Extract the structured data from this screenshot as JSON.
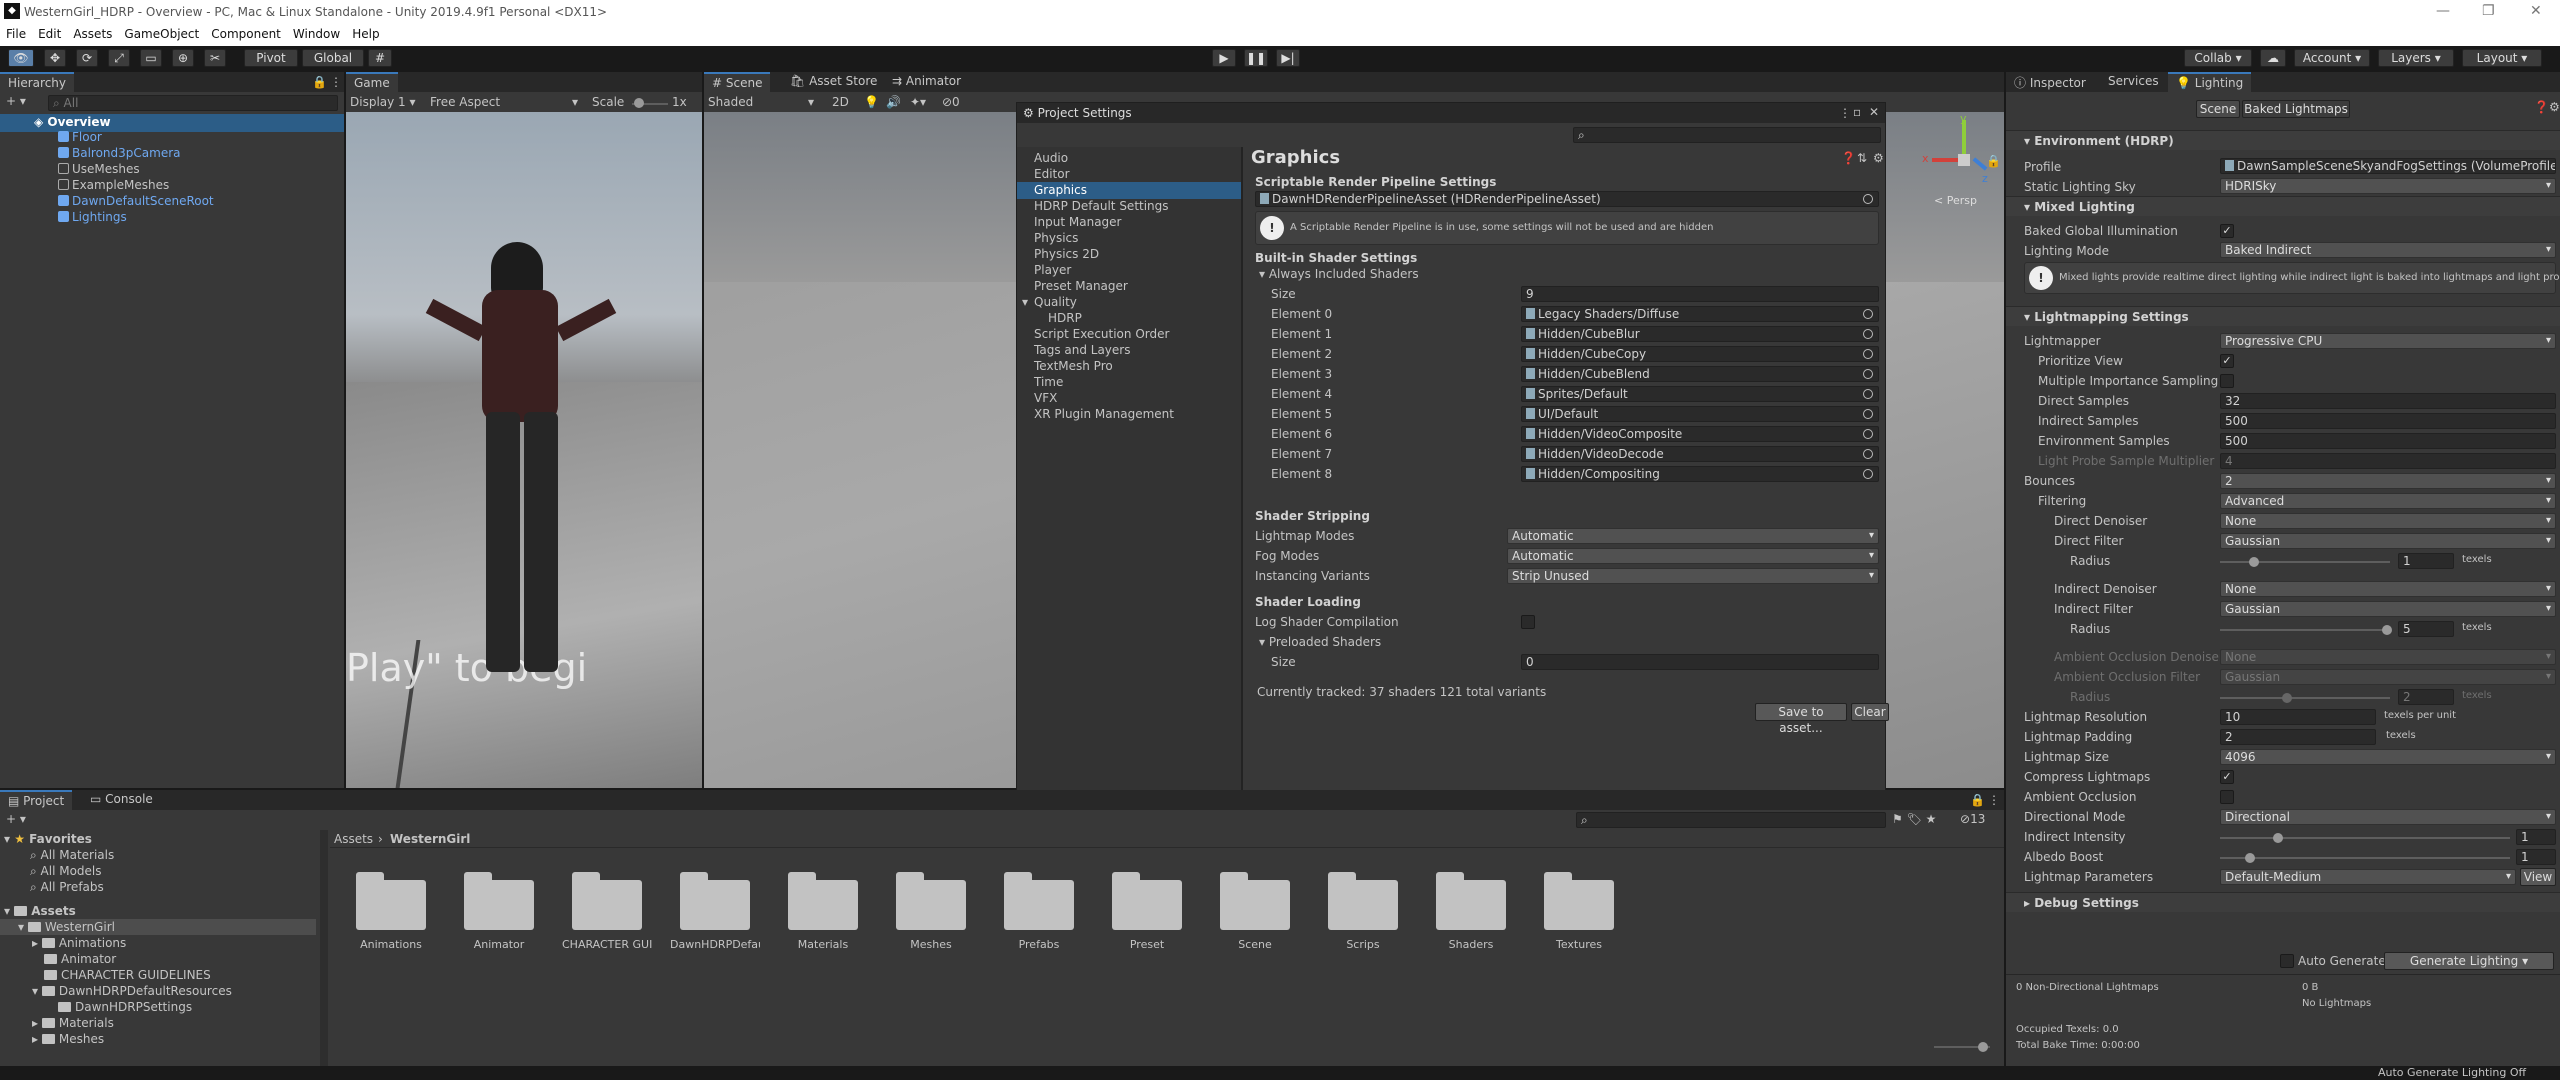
{
  "window": {
    "title": "WesternGirl_HDRP - Overview - PC, Mac & Linux Standalone - Unity 2019.4.9f1 Personal <DX11>",
    "unity_icon": "unity-icon"
  },
  "menu": [
    "File",
    "Edit",
    "Assets",
    "GameObject",
    "Component",
    "Window",
    "Help"
  ],
  "toolbar": {
    "pivot": "Pivot",
    "global": "Global",
    "collab": "Collab ▾",
    "account": "Account",
    "layers": "Layers",
    "layout": "Layout"
  },
  "hierarchy": {
    "tab": "Hierarchy",
    "search_placeholder": "All",
    "scene": "Overview",
    "items": [
      "Floor",
      "Balrond3pCamera",
      "UseMeshes",
      "ExampleMeshes",
      "DawnDefaultSceneRoot",
      "Lightings"
    ]
  },
  "game": {
    "tab": "Game",
    "display": "Display 1",
    "aspect": "Free Aspect",
    "scale_label": "Scale",
    "scale_value": "1x",
    "overlay_text": "Play\" to begi"
  },
  "scene": {
    "tabs": [
      "Scene",
      "Asset Store",
      "Animator"
    ],
    "shading": "Shaded",
    "mode2d": "2D",
    "persp": "< Persp",
    "gizmo_axes": [
      "y",
      "x",
      "z"
    ]
  },
  "project_settings": {
    "title": "Project Settings",
    "nav": [
      "Audio",
      "Editor",
      "Graphics",
      "HDRP Default Settings",
      "Input Manager",
      "Physics",
      "Physics 2D",
      "Player",
      "Preset Manager",
      "Quality",
      "HDRP",
      "Script Execution Order",
      "Tags and Layers",
      "TextMesh Pro",
      "Time",
      "VFX",
      "XR Plugin Management"
    ],
    "heading": "Graphics",
    "srp_header": "Scriptable Render Pipeline Settings",
    "srp_asset": "DawnHDRenderPipelineAsset (HDRenderPipelineAsset)",
    "srp_warning": "A Scriptable Render Pipeline is in use, some settings will not be used and are hidden",
    "builtin_header": "Built-in Shader Settings",
    "always_included": "Always Included Shaders",
    "size_label": "Size",
    "size_value": "9",
    "elements": [
      {
        "label": "Element 0",
        "value": "Legacy Shaders/Diffuse"
      },
      {
        "label": "Element 1",
        "value": "Hidden/CubeBlur"
      },
      {
        "label": "Element 2",
        "value": "Hidden/CubeCopy"
      },
      {
        "label": "Element 3",
        "value": "Hidden/CubeBlend"
      },
      {
        "label": "Element 4",
        "value": "Sprites/Default"
      },
      {
        "label": "Element 5",
        "value": "UI/Default"
      },
      {
        "label": "Element 6",
        "value": "Hidden/VideoComposite"
      },
      {
        "label": "Element 7",
        "value": "Hidden/VideoDecode"
      },
      {
        "label": "Element 8",
        "value": "Hidden/Compositing"
      }
    ],
    "stripping_header": "Shader Stripping",
    "lightmap_modes_label": "Lightmap Modes",
    "lightmap_modes": "Automatic",
    "fog_modes_label": "Fog Modes",
    "fog_modes": "Automatic",
    "instancing_label": "Instancing Variants",
    "instancing": "Strip Unused",
    "loading_header": "Shader Loading",
    "log_label": "Log Shader Compilation",
    "preloaded_label": "Preloaded Shaders",
    "preloaded_size_label": "Size",
    "preloaded_size": "0",
    "tracked": "Currently tracked: 37 shaders 121 total variants",
    "save_btn": "Save to asset...",
    "clear_btn": "Clear"
  },
  "inspector": {
    "tabs": [
      "Inspector",
      "Services",
      "Lighting"
    ],
    "subtabs": [
      "Scene",
      "Baked Lightmaps"
    ],
    "env_header": "Environment (HDRP)",
    "profile_label": "Profile",
    "profile_value": "DawnSampleSceneSkyandFogSettings (VolumeProfile)",
    "static_sky_label": "Static Lighting Sky",
    "static_sky": "HDRISky",
    "mixed_header": "Mixed Lighting",
    "baked_gi_label": "Baked Global Illumination",
    "lighting_mode_label": "Lighting Mode",
    "lighting_mode": "Baked Indirect",
    "mixed_info": "Mixed lights provide realtime direct lighting while indirect light is baked into lightmaps and light probes.",
    "lm_header": "Lightmapping Settings",
    "lightmapper_label": "Lightmapper",
    "lightmapper": "Progressive CPU",
    "prioritize_label": "Prioritize View",
    "mis_label": "Multiple Importance Sampling",
    "direct_samples_label": "Direct Samples",
    "direct_samples": "32",
    "indirect_samples_label": "Indirect Samples",
    "indirect_samples": "500",
    "env_samples_label": "Environment Samples",
    "env_samples": "500",
    "probe_mult_label": "Light Probe Sample Multiplier",
    "probe_mult": "4",
    "bounces_label": "Bounces",
    "bounces": "2",
    "filtering_label": "Filtering",
    "filtering": "Advanced",
    "direct_denoiser_label": "Direct Denoiser",
    "direct_denoiser": "None",
    "direct_filter_label": "Direct Filter",
    "direct_filter": "Gaussian",
    "radius_label": "Radius",
    "radius1": "1",
    "texels": "texels",
    "indirect_denoiser_label": "Indirect Denoiser",
    "indirect_denoiser": "None",
    "indirect_filter_label": "Indirect Filter",
    "indirect_filter": "Gaussian",
    "radius2": "5",
    "ao_denoiser_label": "Ambient Occlusion Denoiser",
    "ao_denoiser": "None",
    "ao_filter_label": "Ambient Occlusion Filter",
    "ao_filter": "Gaussian",
    "radius3": "2",
    "lm_res_label": "Lightmap Resolution",
    "lm_res": "10",
    "texels_per_unit": "texels per unit",
    "lm_pad_label": "Lightmap Padding",
    "lm_pad": "2",
    "lm_size_label": "Lightmap Size",
    "lm_size": "4096",
    "compress_label": "Compress Lightmaps",
    "ao_label": "Ambient Occlusion",
    "dir_mode_label": "Directional Mode",
    "dir_mode": "Directional",
    "indirect_int_label": "Indirect Intensity",
    "indirect_int": "1",
    "albedo_label": "Albedo Boost",
    "albedo": "1",
    "lm_params_label": "Lightmap Parameters",
    "lm_params": "Default-Medium",
    "view_btn": "View",
    "debug_header": "Debug Settings",
    "auto_gen_label": "Auto Generate",
    "generate_btn": "Generate Lighting",
    "non_dir": "0 Non-Directional Lightmaps",
    "size_b": "0 B",
    "no_lm": "No Lightmaps",
    "occupied": "Occupied Texels: 0.0",
    "bake_time": "Total Bake Time: 0:00:00"
  },
  "project": {
    "tabs": [
      "Project",
      "Console"
    ],
    "favorites": "Favorites",
    "fav_items": [
      "All Materials",
      "All Models",
      "All Prefabs"
    ],
    "assets": "Assets",
    "tree": [
      "WesternGirl",
      "Animations",
      "Animator",
      "CHARACTER GUIDELINES",
      "DawnHDRPDefaultResources",
      "DawnHDRPSettings",
      "Materials",
      "Meshes"
    ],
    "breadcrumb": [
      "Assets",
      "WesternGirl"
    ],
    "folders": [
      "Animations",
      "Animator",
      "CHARACTER GUI...",
      "DawnHDRPDefaul...",
      "Materials",
      "Meshes",
      "Prefabs",
      "Preset",
      "Scene",
      "Scrips",
      "Shaders",
      "Textures"
    ],
    "hidden_count": "13"
  },
  "status": {
    "right": "Auto Generate Lighting Off"
  }
}
